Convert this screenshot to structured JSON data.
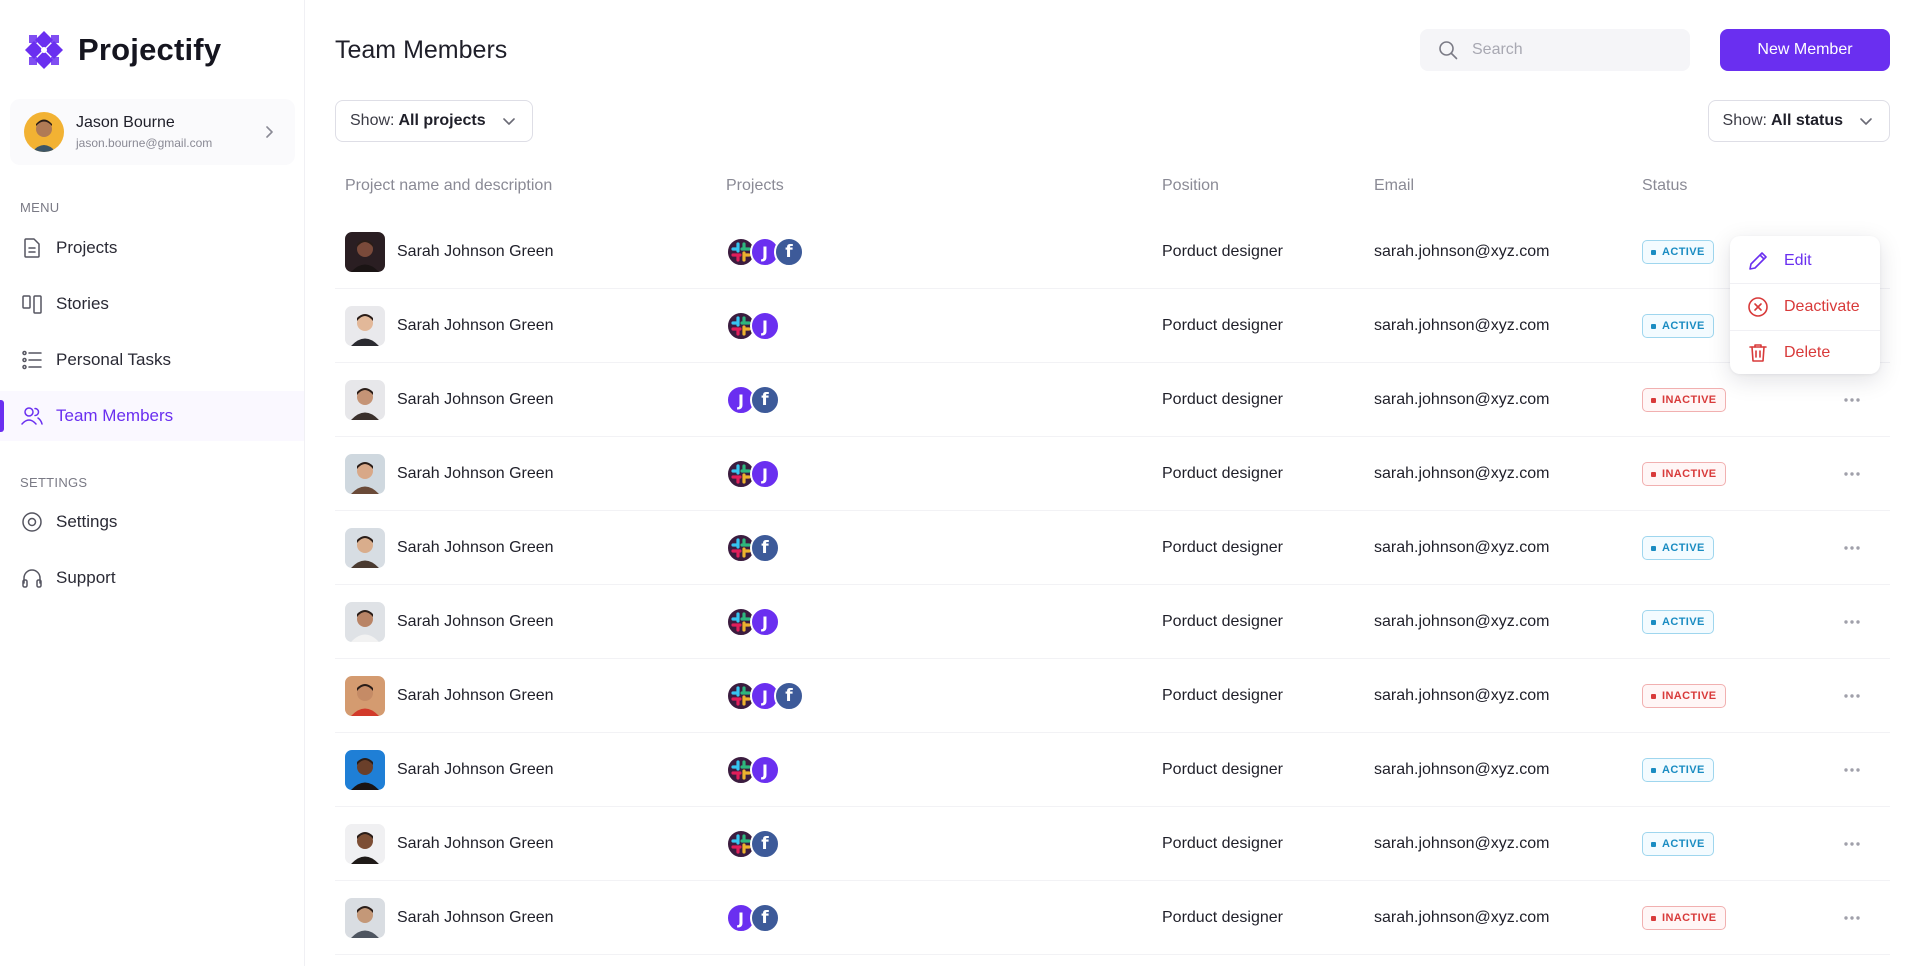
{
  "app": {
    "name": "Projectify"
  },
  "user": {
    "name": "Jason Bourne",
    "email": "jason.bourne@gmail.com"
  },
  "sidebar": {
    "menu_heading": "MENU",
    "settings_heading": "SETTINGS",
    "items": [
      {
        "label": "Projects",
        "icon": "file-icon"
      },
      {
        "label": "Stories",
        "icon": "columns-icon"
      },
      {
        "label": "Personal Tasks",
        "icon": "list-icon"
      },
      {
        "label": "Team Members",
        "icon": "users-icon",
        "active": true
      },
      {
        "label": "Settings",
        "icon": "gear-icon"
      },
      {
        "label": "Support",
        "icon": "headphones-icon"
      }
    ]
  },
  "header": {
    "title": "Team Members",
    "search_placeholder": "Search",
    "new_member_label": "New Member"
  },
  "filters": {
    "projects": {
      "prefix": "Show:",
      "value": "All projects"
    },
    "status": {
      "prefix": "Show:",
      "value": "All status"
    }
  },
  "table": {
    "columns": [
      "Project name and description",
      "Projects",
      "Position",
      "Email",
      "Status"
    ],
    "rows": [
      {
        "name": "Sarah Johnson Green",
        "projects": [
          "slack",
          "jira",
          "facebook"
        ],
        "position": "Porduct designer",
        "email": "sarah.johnson@xyz.com",
        "status": "ACTIVE"
      },
      {
        "name": "Sarah Johnson Green",
        "projects": [
          "slack",
          "jira"
        ],
        "position": "Porduct designer",
        "email": "sarah.johnson@xyz.com",
        "status": "ACTIVE"
      },
      {
        "name": "Sarah Johnson Green",
        "projects": [
          "jira",
          "facebook"
        ],
        "position": "Porduct designer",
        "email": "sarah.johnson@xyz.com",
        "status": "INACTIVE"
      },
      {
        "name": "Sarah Johnson Green",
        "projects": [
          "slack",
          "jira"
        ],
        "position": "Porduct designer",
        "email": "sarah.johnson@xyz.com",
        "status": "INACTIVE"
      },
      {
        "name": "Sarah Johnson Green",
        "projects": [
          "slack",
          "facebook"
        ],
        "position": "Porduct designer",
        "email": "sarah.johnson@xyz.com",
        "status": "ACTIVE"
      },
      {
        "name": "Sarah Johnson Green",
        "projects": [
          "slack",
          "jira"
        ],
        "position": "Porduct designer",
        "email": "sarah.johnson@xyz.com",
        "status": "ACTIVE"
      },
      {
        "name": "Sarah Johnson Green",
        "projects": [
          "slack",
          "jira",
          "facebook"
        ],
        "position": "Porduct designer",
        "email": "sarah.johnson@xyz.com",
        "status": "INACTIVE"
      },
      {
        "name": "Sarah Johnson Green",
        "projects": [
          "slack",
          "jira"
        ],
        "position": "Porduct designer",
        "email": "sarah.johnson@xyz.com",
        "status": "ACTIVE"
      },
      {
        "name": "Sarah Johnson Green",
        "projects": [
          "slack",
          "facebook"
        ],
        "position": "Porduct designer",
        "email": "sarah.johnson@xyz.com",
        "status": "ACTIVE"
      },
      {
        "name": "Sarah Johnson Green",
        "projects": [
          "jira",
          "facebook"
        ],
        "position": "Porduct designer",
        "email": "sarah.johnson@xyz.com",
        "status": "INACTIVE"
      }
    ]
  },
  "context_menu": {
    "items": [
      {
        "label": "Edit",
        "icon": "pencil-icon"
      },
      {
        "label": "Deactivate",
        "icon": "x-circle-icon"
      },
      {
        "label": "Delete",
        "icon": "trash-icon"
      }
    ]
  },
  "colors": {
    "accent": "#6a2ff0",
    "active": "#1a8cc2",
    "inactive": "#d83a3a",
    "jira": "#6a2ff0",
    "facebook": "#3d5a99",
    "slack_bg": "#3b1c3f"
  }
}
